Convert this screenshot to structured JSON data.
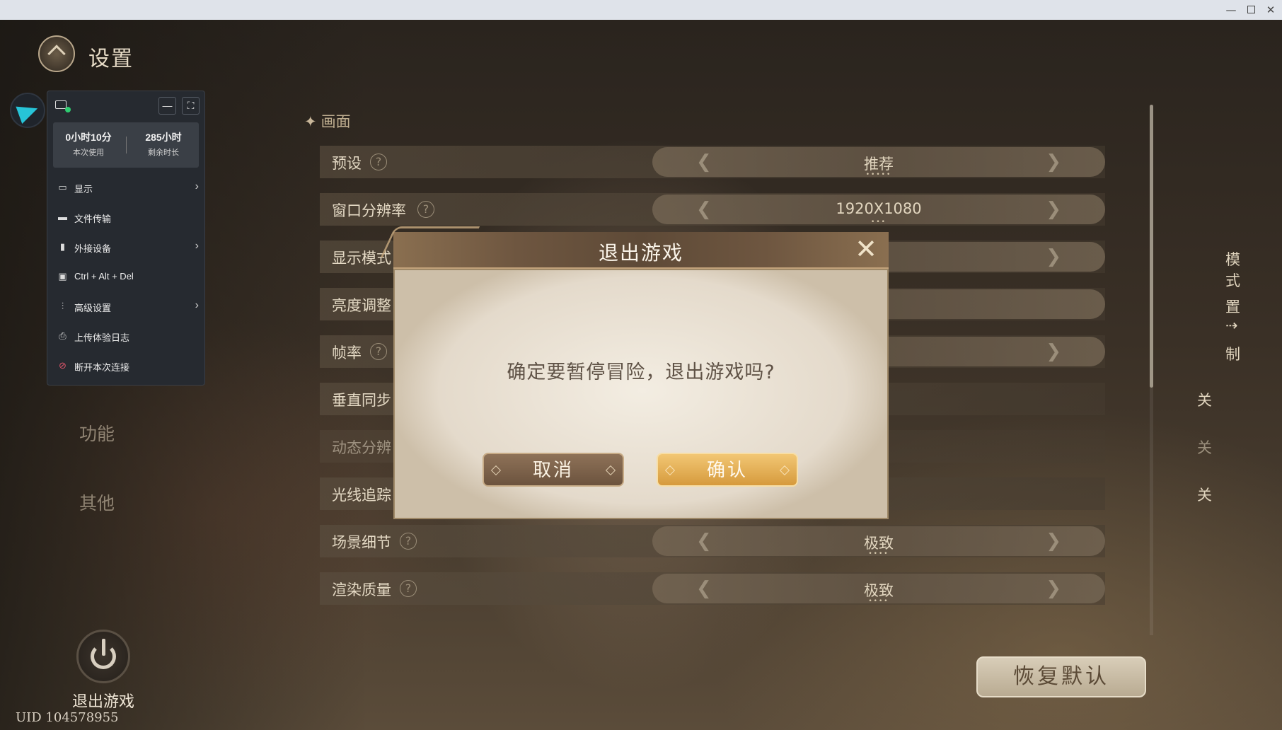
{
  "window": {
    "minimize": "—",
    "close": "✕"
  },
  "game": {
    "title": "设置",
    "categories": {
      "function": "功能",
      "other": "其他"
    },
    "section": "画面",
    "section_mark": "✦",
    "settings": [
      {
        "label": "预设",
        "value": "推荐",
        "dots": "•••••"
      },
      {
        "label": "窗口分辨率",
        "value": "1920X1080",
        "dots": "•••"
      },
      {
        "label": "显示模式",
        "value": "模式"
      },
      {
        "label": "亮度调整",
        "value": "置 ⇢"
      },
      {
        "label": "帧率",
        "value": "制"
      },
      {
        "label": "垂直同步",
        "value": "关"
      },
      {
        "label": "动态分辨",
        "value": "关"
      },
      {
        "label": "光线追踪",
        "value": "关"
      },
      {
        "label": "场景细节",
        "value": "极致",
        "dots": "••••"
      },
      {
        "label": "渲染质量",
        "value": "极致",
        "dots": "••••"
      }
    ],
    "help_mark": "?",
    "arrow_left": "❮",
    "arrow_right": "❯",
    "restore_default": "恢复默认",
    "exit_game": "退出游戏",
    "uid": "UID 104578955"
  },
  "cloud_panel": {
    "minimize": "—",
    "fullscreen": "⛶",
    "session_time": "0小时10分",
    "session_label": "本次使用",
    "remaining_time": "285小时",
    "remaining_label": "剩余时长",
    "menu": [
      {
        "label": "显示",
        "icon": "monitor-icon",
        "glyph": "▭",
        "arrow": "›"
      },
      {
        "label": "文件传输",
        "icon": "folder-icon",
        "glyph": "▬"
      },
      {
        "label": "外接设备",
        "icon": "usb-icon",
        "glyph": "▮",
        "arrow": "›"
      },
      {
        "label": "Ctrl + Alt + Del",
        "icon": "screen-icon",
        "glyph": "▣"
      },
      {
        "label": "高级设置",
        "icon": "sliders-icon",
        "glyph": "⫶",
        "arrow": "›"
      },
      {
        "label": "上传体验日志",
        "icon": "upload-log-icon",
        "glyph": "⎙"
      },
      {
        "label": "断开本次连接",
        "icon": "disconnect-icon",
        "glyph": "⊘"
      }
    ]
  },
  "modal": {
    "title": "退出游戏",
    "message": "确定要暂停冒险，退出游戏吗?",
    "cancel": "取消",
    "confirm": "确认",
    "close": "✕"
  }
}
